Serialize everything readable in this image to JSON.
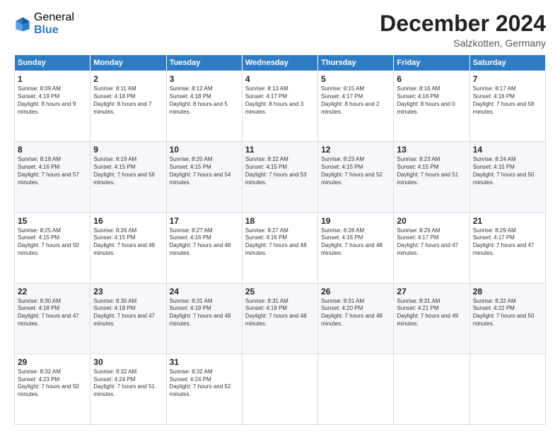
{
  "logo": {
    "general": "General",
    "blue": "Blue"
  },
  "header": {
    "month": "December 2024",
    "location": "Salzkotten, Germany"
  },
  "weekdays": [
    "Sunday",
    "Monday",
    "Tuesday",
    "Wednesday",
    "Thursday",
    "Friday",
    "Saturday"
  ],
  "weeks": [
    [
      {
        "day": "1",
        "sunrise": "Sunrise: 8:09 AM",
        "sunset": "Sunset: 4:19 PM",
        "daylight": "Daylight: 8 hours and 9 minutes."
      },
      {
        "day": "2",
        "sunrise": "Sunrise: 8:11 AM",
        "sunset": "Sunset: 4:18 PM",
        "daylight": "Daylight: 8 hours and 7 minutes."
      },
      {
        "day": "3",
        "sunrise": "Sunrise: 8:12 AM",
        "sunset": "Sunset: 4:18 PM",
        "daylight": "Daylight: 8 hours and 5 minutes."
      },
      {
        "day": "4",
        "sunrise": "Sunrise: 8:13 AM",
        "sunset": "Sunset: 4:17 PM",
        "daylight": "Daylight: 8 hours and 3 minutes."
      },
      {
        "day": "5",
        "sunrise": "Sunrise: 8:15 AM",
        "sunset": "Sunset: 4:17 PM",
        "daylight": "Daylight: 8 hours and 2 minutes."
      },
      {
        "day": "6",
        "sunrise": "Sunrise: 8:16 AM",
        "sunset": "Sunset: 4:16 PM",
        "daylight": "Daylight: 8 hours and 0 minutes."
      },
      {
        "day": "7",
        "sunrise": "Sunrise: 8:17 AM",
        "sunset": "Sunset: 4:16 PM",
        "daylight": "Daylight: 7 hours and 58 minutes."
      }
    ],
    [
      {
        "day": "8",
        "sunrise": "Sunrise: 8:18 AM",
        "sunset": "Sunset: 4:16 PM",
        "daylight": "Daylight: 7 hours and 57 minutes."
      },
      {
        "day": "9",
        "sunrise": "Sunrise: 8:19 AM",
        "sunset": "Sunset: 4:15 PM",
        "daylight": "Daylight: 7 hours and 56 minutes."
      },
      {
        "day": "10",
        "sunrise": "Sunrise: 8:20 AM",
        "sunset": "Sunset: 4:15 PM",
        "daylight": "Daylight: 7 hours and 54 minutes."
      },
      {
        "day": "11",
        "sunrise": "Sunrise: 8:22 AM",
        "sunset": "Sunset: 4:15 PM",
        "daylight": "Daylight: 7 hours and 53 minutes."
      },
      {
        "day": "12",
        "sunrise": "Sunrise: 8:23 AM",
        "sunset": "Sunset: 4:15 PM",
        "daylight": "Daylight: 7 hours and 52 minutes."
      },
      {
        "day": "13",
        "sunrise": "Sunrise: 8:23 AM",
        "sunset": "Sunset: 4:15 PM",
        "daylight": "Daylight: 7 hours and 51 minutes."
      },
      {
        "day": "14",
        "sunrise": "Sunrise: 8:24 AM",
        "sunset": "Sunset: 4:15 PM",
        "daylight": "Daylight: 7 hours and 50 minutes."
      }
    ],
    [
      {
        "day": "15",
        "sunrise": "Sunrise: 8:25 AM",
        "sunset": "Sunset: 4:15 PM",
        "daylight": "Daylight: 7 hours and 50 minutes."
      },
      {
        "day": "16",
        "sunrise": "Sunrise: 8:26 AM",
        "sunset": "Sunset: 4:15 PM",
        "daylight": "Daylight: 7 hours and 49 minutes."
      },
      {
        "day": "17",
        "sunrise": "Sunrise: 8:27 AM",
        "sunset": "Sunset: 4:16 PM",
        "daylight": "Daylight: 7 hours and 48 minutes."
      },
      {
        "day": "18",
        "sunrise": "Sunrise: 8:27 AM",
        "sunset": "Sunset: 4:16 PM",
        "daylight": "Daylight: 7 hours and 48 minutes."
      },
      {
        "day": "19",
        "sunrise": "Sunrise: 8:28 AM",
        "sunset": "Sunset: 4:16 PM",
        "daylight": "Daylight: 7 hours and 48 minutes."
      },
      {
        "day": "20",
        "sunrise": "Sunrise: 8:29 AM",
        "sunset": "Sunset: 4:17 PM",
        "daylight": "Daylight: 7 hours and 47 minutes."
      },
      {
        "day": "21",
        "sunrise": "Sunrise: 8:29 AM",
        "sunset": "Sunset: 4:17 PM",
        "daylight": "Daylight: 7 hours and 47 minutes."
      }
    ],
    [
      {
        "day": "22",
        "sunrise": "Sunrise: 8:30 AM",
        "sunset": "Sunset: 4:18 PM",
        "daylight": "Daylight: 7 hours and 47 minutes."
      },
      {
        "day": "23",
        "sunrise": "Sunrise: 8:30 AM",
        "sunset": "Sunset: 4:18 PM",
        "daylight": "Daylight: 7 hours and 47 minutes."
      },
      {
        "day": "24",
        "sunrise": "Sunrise: 8:31 AM",
        "sunset": "Sunset: 4:19 PM",
        "daylight": "Daylight: 7 hours and 48 minutes."
      },
      {
        "day": "25",
        "sunrise": "Sunrise: 8:31 AM",
        "sunset": "Sunset: 4:19 PM",
        "daylight": "Daylight: 7 hours and 48 minutes."
      },
      {
        "day": "26",
        "sunrise": "Sunrise: 8:31 AM",
        "sunset": "Sunset: 4:20 PM",
        "daylight": "Daylight: 7 hours and 48 minutes."
      },
      {
        "day": "27",
        "sunrise": "Sunrise: 8:31 AM",
        "sunset": "Sunset: 4:21 PM",
        "daylight": "Daylight: 7 hours and 49 minutes."
      },
      {
        "day": "28",
        "sunrise": "Sunrise: 8:32 AM",
        "sunset": "Sunset: 4:22 PM",
        "daylight": "Daylight: 7 hours and 50 minutes."
      }
    ],
    [
      {
        "day": "29",
        "sunrise": "Sunrise: 8:32 AM",
        "sunset": "Sunset: 4:23 PM",
        "daylight": "Daylight: 7 hours and 50 minutes."
      },
      {
        "day": "30",
        "sunrise": "Sunrise: 8:32 AM",
        "sunset": "Sunset: 4:24 PM",
        "daylight": "Daylight: 7 hours and 51 minutes."
      },
      {
        "day": "31",
        "sunrise": "Sunrise: 8:32 AM",
        "sunset": "Sunset: 4:24 PM",
        "daylight": "Daylight: 7 hours and 52 minutes."
      },
      null,
      null,
      null,
      null
    ]
  ]
}
